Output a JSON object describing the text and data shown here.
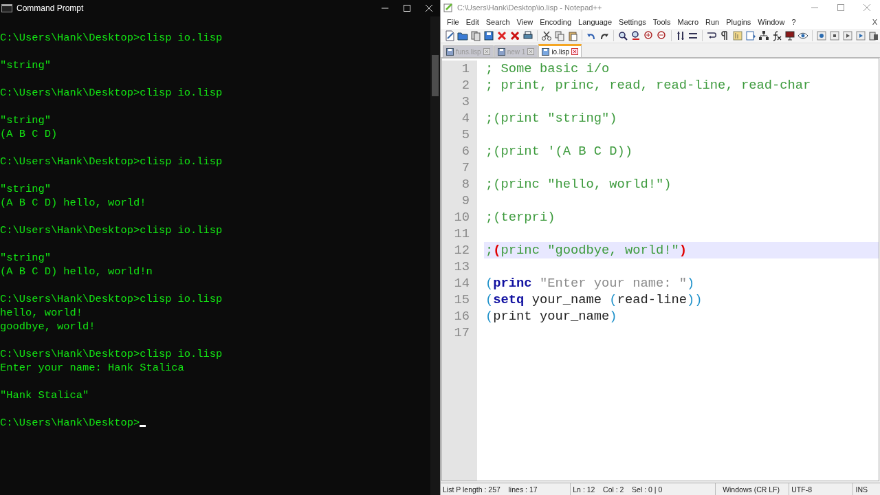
{
  "console_window": {
    "title": "Command Prompt",
    "lines": [
      {
        "text": "C:\\Users\\Hank\\Desktop>clisp io.lisp",
        "blank_before": true
      },
      {
        "text": "\"string\"",
        "blank_before": true
      },
      {
        "text": "C:\\Users\\Hank\\Desktop>clisp io.lisp",
        "blank_before": true
      },
      {
        "text": "\"string\"",
        "blank_before": true
      },
      {
        "text": "(A B C D)",
        "blank_before": false
      },
      {
        "text": "C:\\Users\\Hank\\Desktop>clisp io.lisp",
        "blank_before": true
      },
      {
        "text": "\"string\"",
        "blank_before": true
      },
      {
        "text": "(A B C D) hello, world!",
        "blank_before": false
      },
      {
        "text": "C:\\Users\\Hank\\Desktop>clisp io.lisp",
        "blank_before": true
      },
      {
        "text": "\"string\"",
        "blank_before": true
      },
      {
        "text": "(A B C D) hello, world!n",
        "blank_before": false
      },
      {
        "text": "C:\\Users\\Hank\\Desktop>clisp io.lisp",
        "blank_before": true
      },
      {
        "text": "hello, world!",
        "blank_before": false
      },
      {
        "text": "goodbye, world!",
        "blank_before": false
      },
      {
        "text": "C:\\Users\\Hank\\Desktop>clisp io.lisp",
        "blank_before": true
      },
      {
        "text": "Enter your name: Hank Stalica",
        "blank_before": false
      },
      {
        "text": "\"Hank Stalica\"",
        "blank_before": true
      },
      {
        "text": "C:\\Users\\Hank\\Desktop>",
        "blank_before": true
      }
    ]
  },
  "editor_window": {
    "title": "C:\\Users\\Hank\\Desktop\\io.lisp - Notepad++",
    "menu": [
      "File",
      "Edit",
      "Search",
      "View",
      "Encoding",
      "Language",
      "Settings",
      "Tools",
      "Macro",
      "Run",
      "Plugins",
      "Window",
      "?"
    ],
    "close_document": "X",
    "tabs": [
      {
        "label": "funs.lisp",
        "selected": false
      },
      {
        "label": "new 1",
        "selected": false
      },
      {
        "label": "io.lisp",
        "selected": true
      }
    ],
    "code_lines": [
      {
        "number": "1",
        "selected": false,
        "tokens": [
          {
            "kind": "comment",
            "text": "; Some basic i/o"
          }
        ]
      },
      {
        "number": "2",
        "selected": false,
        "tokens": [
          {
            "kind": "comment",
            "text": "; print, princ, read, read-line, read-char"
          }
        ]
      },
      {
        "number": "3",
        "selected": false
      },
      {
        "number": "4",
        "selected": false,
        "tokens": [
          {
            "kind": "comment",
            "text": ";(print \"string\")"
          }
        ]
      },
      {
        "number": "5",
        "selected": false
      },
      {
        "number": "6",
        "selected": false,
        "tokens": [
          {
            "kind": "comment",
            "text": ";(print '(A B C D))"
          }
        ]
      },
      {
        "number": "7",
        "selected": false
      },
      {
        "number": "8",
        "selected": false,
        "tokens": [
          {
            "kind": "comment",
            "text": ";(princ \"hello, world!\")"
          }
        ]
      },
      {
        "number": "9",
        "selected": false
      },
      {
        "number": "10",
        "selected": false,
        "tokens": [
          {
            "kind": "comment",
            "text": ";(terpri)"
          }
        ]
      },
      {
        "number": "11",
        "selected": false
      },
      {
        "number": "12",
        "selected": true,
        "tokens": [
          {
            "kind": "comment",
            "text": ";"
          },
          {
            "kind": "brace_match",
            "text": "("
          },
          {
            "kind": "comment",
            "text": "princ \"goodbye, world!\""
          },
          {
            "kind": "brace_match",
            "text": ")"
          }
        ]
      },
      {
        "number": "13",
        "selected": false
      },
      {
        "number": "14",
        "selected": false,
        "tokens": [
          {
            "kind": "paren",
            "text": "("
          },
          {
            "kind": "keyword",
            "text": "princ"
          },
          {
            "kind": "string",
            "text": " \"Enter your name: \""
          },
          {
            "kind": "paren",
            "text": ")"
          }
        ]
      },
      {
        "number": "15",
        "selected": false,
        "tokens": [
          {
            "kind": "paren",
            "text": "("
          },
          {
            "kind": "keyword",
            "text": "setq"
          },
          {
            "kind": "plain",
            "text": " your_name "
          },
          {
            "kind": "paren",
            "text": "("
          },
          {
            "kind": "plain",
            "text": "read-line"
          },
          {
            "kind": "paren",
            "text": "))"
          }
        ]
      },
      {
        "number": "16",
        "selected": false,
        "tokens": [
          {
            "kind": "paren",
            "text": "("
          },
          {
            "kind": "plain",
            "text": "print your_name"
          },
          {
            "kind": "paren",
            "text": ")"
          }
        ]
      },
      {
        "number": "17",
        "selected": false
      }
    ],
    "status_bar": [
      "List P length : 257    lines : 17",
      "Ln : 12    Col : 2    Sel : 0 | 0",
      "Windows (CR LF)",
      "UTF-8",
      "INS"
    ]
  }
}
